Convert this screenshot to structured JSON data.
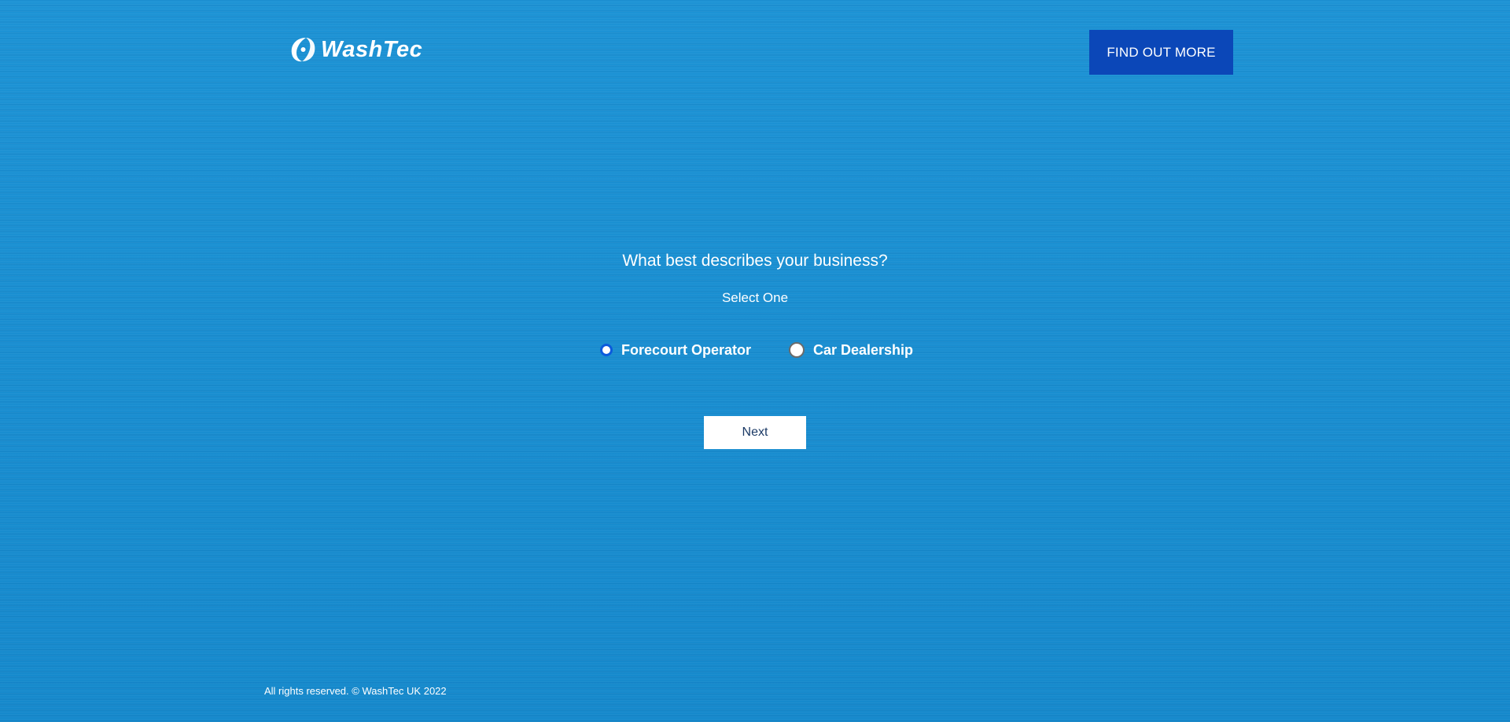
{
  "header": {
    "logo_text": "WashTec",
    "logo_icon": "washtec-logo-mark",
    "cta_label": "FIND OUT MORE"
  },
  "form": {
    "question": "What best describes your business?",
    "hint": "Select One",
    "options": [
      {
        "label": "Forecourt Operator",
        "selected": false,
        "focused": true
      },
      {
        "label": "Car Dealership",
        "selected": false,
        "focused": false
      }
    ],
    "next_label": "Next"
  },
  "footer": {
    "copyright": "All rights reserved. © WashTec UK 2022"
  },
  "colors": {
    "background": "#1a8fd2",
    "cta_background": "#0b47b8",
    "next_text": "#1b3a66",
    "radio_focus": "#0b5bdc"
  }
}
